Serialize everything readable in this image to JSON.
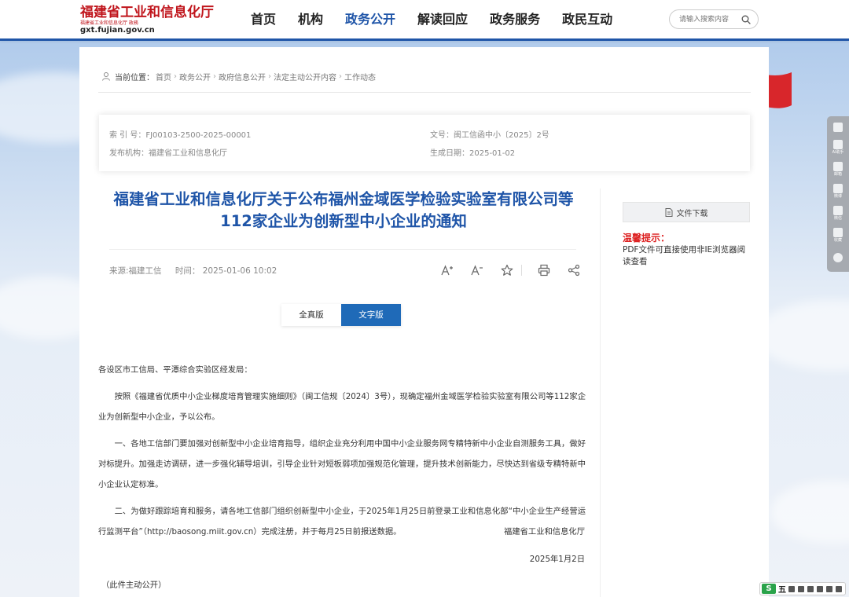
{
  "header": {
    "logo_title": "福建省工业和信息化厅",
    "logo_sub": "福建省工业和信息化厅 政務",
    "logo_domain": "gxt.fujian.gov.cn",
    "nav": [
      "首页",
      "机构",
      "政务公开",
      "解读回应",
      "政务服务",
      "政民互动"
    ],
    "active_nav": "政务公开",
    "search_placeholder": "请输入搜索内容"
  },
  "breadcrumb": {
    "label": "当前位置：",
    "items": [
      "首页",
      "政务公开",
      "政府信息公开",
      "法定主动公开内容",
      "工作动态"
    ]
  },
  "meta": {
    "index_no": "索 引 号：FJ00103-2500-2025-00001",
    "doc_no": "文号：闽工信函中小〔2025〕2号",
    "publisher": "发布机构：福建省工业和信息化厅",
    "date": "生成日期：2025-01-02"
  },
  "article": {
    "title": "福建省工业和信息化厅关于公布福州金域医学检验实验室有限公司等112家企业为创新型中小企业的通知",
    "source": "来源:福建工信",
    "time": "时间：  2025-01-06 10:02",
    "tabs": [
      "全真版",
      "文字版"
    ],
    "active_tab": "文字版",
    "salutation": "各设区市工信局、平潭综合实验区经发局：",
    "paragraphs": [
      "按照《福建省优质中小企业梯度培育管理实施细则》（闽工信规〔2024〕3号），现确定福州金域医学检验实验室有限公司等112家企业为创新型中小企业，予以公布。",
      "一、各地工信部门要加强对创新型中小企业培育指导，组织企业充分利用中国中小企业服务网专精特新中小企业自测服务工具，做好对标提升。加强走访调研，进一步强化辅导培训，引导企业针对短板弱项加强规范化管理，提升技术创新能力，尽快达到省级专精特新中小企业认定标准。",
      "二、为做好跟踪培育和服务，请各地工信部门组织创新型中小企业，于2025年1月25日前登录工业和信息化部“中小企业生产经营运行监测平台”（http://baosong.miit.gov.cn）完成注册，并于每月25日前报送数据。"
    ],
    "signer": "福建省工业和信息化厅",
    "sign_date": "2025年1月2日",
    "note": "（此件主动公开）"
  },
  "sidebar": {
    "download_label": "文件下载",
    "tip_title": "温馨提示：",
    "tip_text": "PDF文件可直接使用非IE浏览器阅读查看"
  },
  "float_bar": {
    "items": [
      "",
      "AI助手",
      "邮箱",
      "微博",
      "微信",
      "收藏"
    ]
  },
  "ime": {
    "logo": "S",
    "mode": "五"
  },
  "colors": {
    "brand_blue": "#1f55a8",
    "brand_red": "#c0151c",
    "tip_red": "#dd2222"
  }
}
